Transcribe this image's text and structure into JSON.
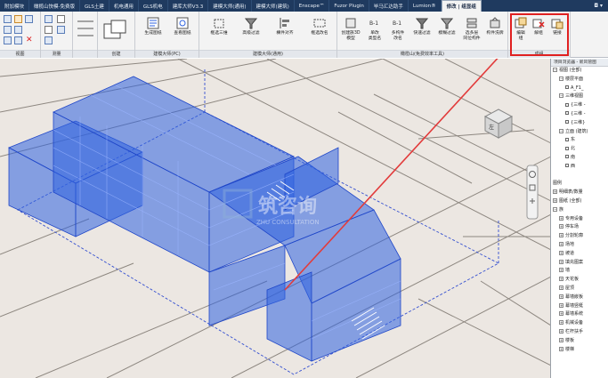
{
  "tabs": [
    "附加模块",
    "橄榄山快模-免费版",
    "GLS土建",
    "机电通用",
    "GLS机电",
    "建库大师V3.3",
    "建模大师(通用)",
    "建模大师(建筑)",
    "Enscape™",
    "Fuzor Plugin",
    "毕马汇达助手",
    "Lumion®",
    "修改 | 组显组"
  ],
  "active_tab_index": 12,
  "tab_controls": "◘ ▾",
  "panels": {
    "view": {
      "title": "视图"
    },
    "measure": {
      "title": "测量"
    },
    "create": {
      "title": "创建"
    },
    "model_pc": {
      "title": "建模大师(PC)",
      "buttons": [
        "生成图纸",
        "查看图纸"
      ]
    },
    "model_general": {
      "title": "建模大师(通用)",
      "buttons": [
        "框选三维",
        "高级过滤",
        "構件对齐",
        "框选改名"
      ]
    },
    "olive": {
      "title": "橄榄山(免费效率工具)",
      "buttons": [
        "创建族3D\n模型",
        "单改\n类型名",
        "多构件\n改名",
        "快速过滤",
        "模糊过滤",
        "选多层\n同位构件",
        "构件洗牌"
      ]
    },
    "group": {
      "title": "成组",
      "buttons": [
        "编辑\n组",
        "解组",
        "链接"
      ]
    }
  },
  "browser": {
    "title": "项目浏览器 - 新风管图",
    "items": [
      {
        "level": 0,
        "toggle": "⊟",
        "label": "视图 (全部)"
      },
      {
        "level": 1,
        "toggle": "⊟",
        "label": "楼层平面"
      },
      {
        "level": 2,
        "toggle": "",
        "label": "A_F1_"
      },
      {
        "level": 1,
        "toggle": "⊟",
        "label": "三维视图"
      },
      {
        "level": 2,
        "toggle": "",
        "label": "{三维 -"
      },
      {
        "level": 2,
        "toggle": "",
        "label": "{三维 -"
      },
      {
        "level": 2,
        "toggle": "",
        "label": "{三维}"
      },
      {
        "level": 1,
        "toggle": "⊟",
        "label": "立面 (建筑)"
      },
      {
        "level": 2,
        "toggle": "",
        "label": "东"
      },
      {
        "level": 2,
        "toggle": "",
        "label": "北"
      },
      {
        "level": 2,
        "toggle": "",
        "label": "南"
      },
      {
        "level": 2,
        "toggle": "",
        "label": "西"
      },
      {
        "level": 0,
        "toggle": "",
        "label": ""
      },
      {
        "level": 0,
        "toggle": "",
        "label": "图例"
      },
      {
        "level": 0,
        "toggle": "⊞",
        "label": "明细表/数量"
      },
      {
        "level": 0,
        "toggle": "⊞",
        "label": "图纸 (全部)"
      },
      {
        "level": 0,
        "toggle": "⊟",
        "label": "族"
      },
      {
        "level": 1,
        "toggle": "⊞",
        "label": "专用设备"
      },
      {
        "level": 1,
        "toggle": "⊞",
        "label": "停车场"
      },
      {
        "level": 1,
        "toggle": "⊞",
        "label": "分割轮廓"
      },
      {
        "level": 1,
        "toggle": "⊞",
        "label": "场地"
      },
      {
        "level": 1,
        "toggle": "⊞",
        "label": "坡道"
      },
      {
        "level": 1,
        "toggle": "⊞",
        "label": "填充图案"
      },
      {
        "level": 1,
        "toggle": "⊞",
        "label": "墙"
      },
      {
        "level": 1,
        "toggle": "⊞",
        "label": "天花板"
      },
      {
        "level": 1,
        "toggle": "⊞",
        "label": "屋顶"
      },
      {
        "level": 1,
        "toggle": "⊞",
        "label": "幕墙嵌板"
      },
      {
        "level": 1,
        "toggle": "⊞",
        "label": "幕墙竖梃"
      },
      {
        "level": 1,
        "toggle": "⊞",
        "label": "幕墙系统"
      },
      {
        "level": 1,
        "toggle": "⊞",
        "label": "机械设备"
      },
      {
        "level": 1,
        "toggle": "⊞",
        "label": "栏杆扶手"
      },
      {
        "level": 1,
        "toggle": "⊞",
        "label": "楼板"
      },
      {
        "level": 1,
        "toggle": "⊞",
        "label": "楼梯"
      }
    ]
  },
  "viewcube": {
    "label": "左"
  },
  "watermark": {
    "title": "筑咨询",
    "subtitle": "ZHU CONSULTATION"
  },
  "colors": {
    "tab_bar": "#1f3a5f",
    "model_blue": "#2f63e0",
    "highlight": "#e02020",
    "arrow": "#e23b3b"
  }
}
